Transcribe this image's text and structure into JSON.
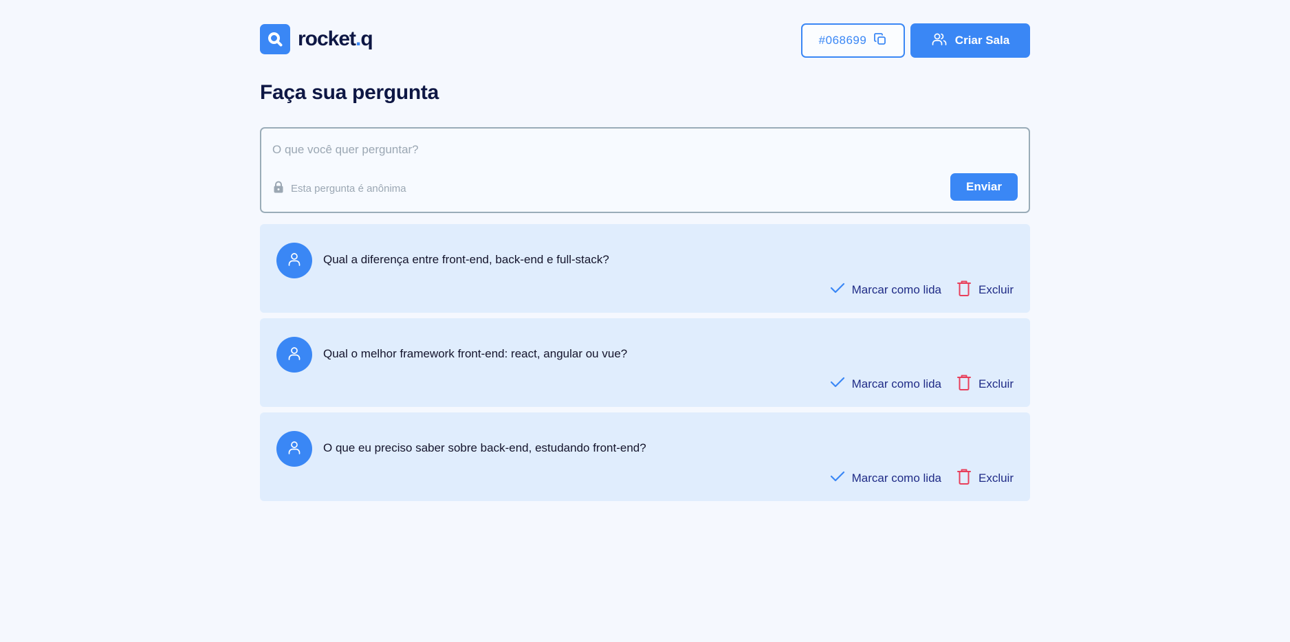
{
  "header": {
    "logo_text": "rocket",
    "logo_dot": ".",
    "logo_suffix": "q",
    "room_code": "#068699",
    "create_room_label": "Criar Sala"
  },
  "page_title": "Faça sua pergunta",
  "form": {
    "placeholder": "O que você quer perguntar?",
    "anonymous_text": "Esta pergunta é anônima",
    "send_label": "Enviar"
  },
  "questions": [
    {
      "text": "Qual a diferença entre front-end, back-end e full-stack?",
      "mark_read_label": "Marcar como lida",
      "delete_label": "Excluir"
    },
    {
      "text": "Qual o melhor framework front-end: react, angular ou vue?",
      "mark_read_label": "Marcar como lida",
      "delete_label": "Excluir"
    },
    {
      "text": "O que eu preciso saber sobre back-end, estudando front-end?",
      "mark_read_label": "Marcar como lida",
      "delete_label": "Excluir"
    }
  ],
  "colors": {
    "accent": "#3a87f5",
    "title": "#0e1744",
    "card": "#e0edfd",
    "background": "#f5f8fe",
    "danger": "#e83f5b"
  },
  "icons": {
    "logo": "search-logo-icon",
    "copy": "copy-icon",
    "users": "users-icon",
    "lock": "lock-icon",
    "user": "user-icon",
    "check": "check-icon",
    "trash": "trash-icon"
  }
}
